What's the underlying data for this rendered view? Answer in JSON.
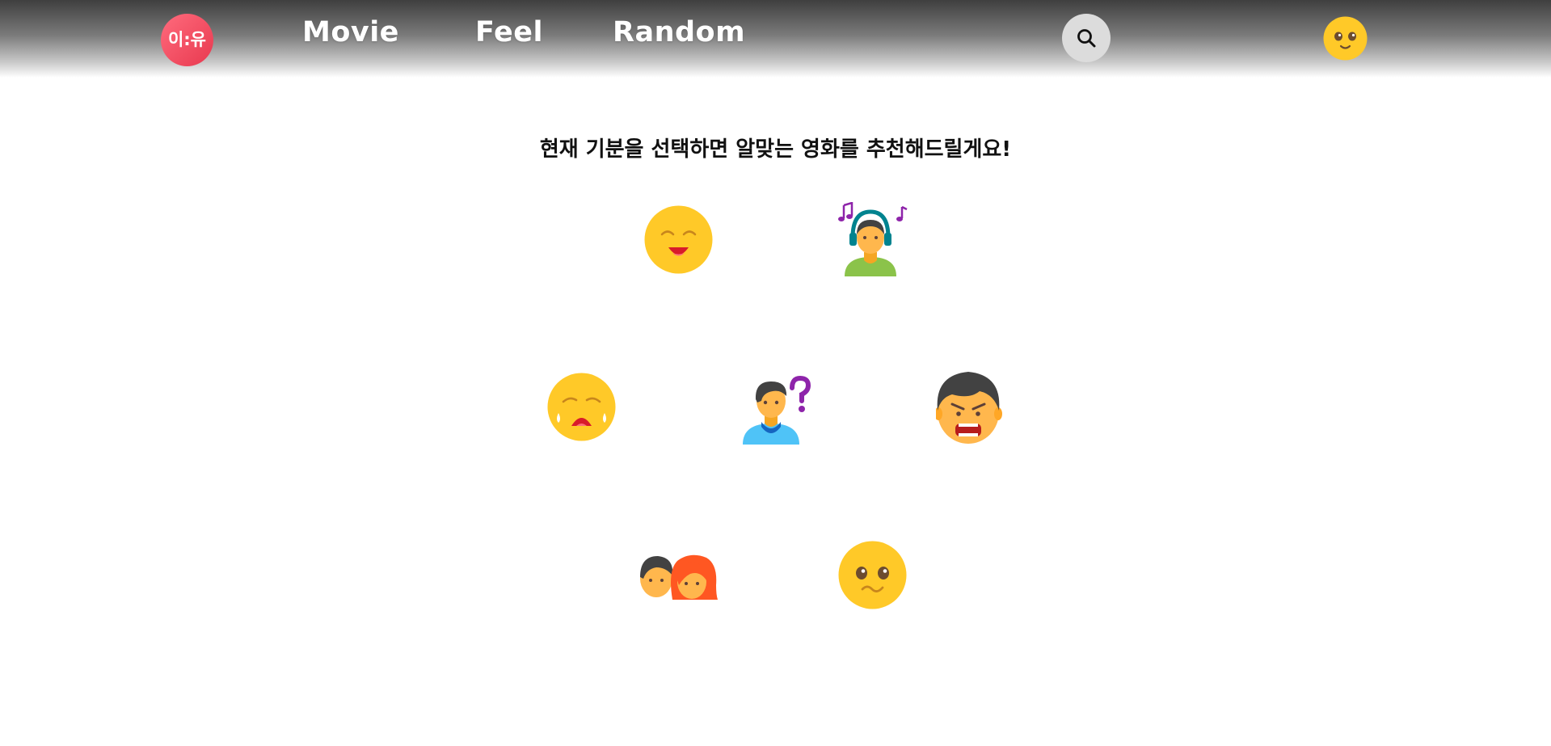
{
  "header": {
    "logo_text": "이:유",
    "nav": [
      {
        "label": "Movie"
      },
      {
        "label": "Feel"
      },
      {
        "label": "Random"
      }
    ],
    "search_icon": "search-icon",
    "avatar_icon": "smiling-face-icon"
  },
  "main": {
    "heading": "현재 기분을 선택하면 알맞는 영화를 추천해드릴게요!",
    "moods": [
      {
        "icon": "happy-face-icon"
      },
      {
        "icon": "music-listener-icon"
      },
      {
        "icon": "crying-face-icon"
      },
      {
        "icon": "confused-person-icon"
      },
      {
        "icon": "angry-person-icon"
      },
      {
        "icon": "couple-icon"
      },
      {
        "icon": "worried-face-icon"
      }
    ]
  },
  "colors": {
    "logo": "#e8394f",
    "emoji_yellow": "#ffc928",
    "accent_purple": "#8e24aa"
  }
}
